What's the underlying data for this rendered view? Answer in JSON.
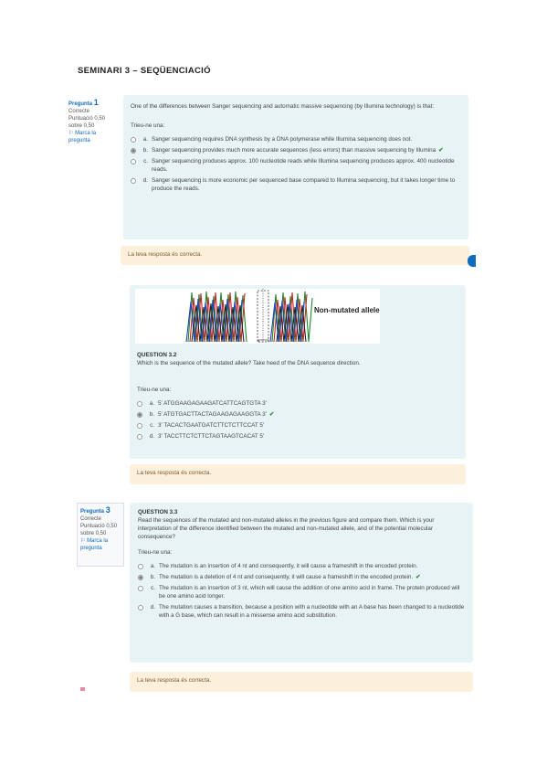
{
  "title": "SEMINARI 3 – SEQÜENCIACIÓ",
  "q1": {
    "info": {
      "label": "Pregunta",
      "number": "1",
      "status": "Correcte",
      "score": "Puntuació 0,50 sobre 0,50",
      "flag": "Marca la pregunta"
    },
    "text": "One of the differences between Sanger sequencing and automatic massive sequencing (by Illumina technology) is that:",
    "prompt": "Trieu-ne una:",
    "answers": [
      {
        "letter": "a.",
        "text": "Sanger sequencing requires DNA synthesis by a DNA polymerase while Illumina sequencing does not.",
        "selected": false,
        "correct": false
      },
      {
        "letter": "b.",
        "text": "Sanger sequencing provides much more accurate sequences (less errors) than massive sequencing by Illumina",
        "selected": true,
        "correct": true
      },
      {
        "letter": "c.",
        "text": "Sanger sequencing produces approx. 100 nucleotide reads while Illumina sequencing produces approx. 400 nucleotide reads.",
        "selected": false,
        "correct": false
      },
      {
        "letter": "d.",
        "text": "Sanger sequencing is more economic per sequenced base compared to Illumina sequencing, but it takes longer time to produce the reads.",
        "selected": false,
        "correct": false
      }
    ],
    "feedback": "La teva resposta és correcta."
  },
  "q2": {
    "chromatogram_label": "Non-mutated allele",
    "heading": "QUESTION 3.2",
    "text": "Which is the sequence of the mutated allele? Take heed of the DNA sequence direction.",
    "prompt": "Trieu-ne una:",
    "answers": [
      {
        "letter": "a.",
        "text": "5' ATGGAAGAGAAGATCATTCAGTGTA 3'",
        "selected": false,
        "correct": false
      },
      {
        "letter": "b.",
        "text": "5' ATGTGACTTACTAGAAGAGAAGGTA 3'",
        "selected": true,
        "correct": true
      },
      {
        "letter": "c.",
        "text": "3' TACACTGAATGATCTTCTCTTCCAT 5'",
        "selected": false,
        "correct": false
      },
      {
        "letter": "d.",
        "text": "3' TACCTTCTCTTCTAGTAAGTCACAT 5'",
        "selected": false,
        "correct": false
      }
    ],
    "feedback": "La teva resposta és correcta."
  },
  "q3": {
    "info": {
      "label": "Pregunta",
      "number": "3",
      "status": "Correcte",
      "score": "Puntuació 0,50 sobre 0,50",
      "flag": "Marca la pregunta"
    },
    "heading": "QUESTION 3.3",
    "text": "Read the sequences of the mutated and non-mutated alleles in the previous figure and compare them. Which is your interpretation of the difference identified between the mutated and non-mutated allele, and of the potential molecular consequence?",
    "prompt": "Trieu-ne una:",
    "answers": [
      {
        "letter": "a.",
        "text": "The mutation is an insertion of 4 nt and consequently, it will cause a frameshift in the encoded protein.",
        "selected": false,
        "correct": false
      },
      {
        "letter": "b.",
        "text": "The mutation is a deletion of 4 nt and consequently, it will cause a frameshift in the encoded protein.",
        "selected": true,
        "correct": true
      },
      {
        "letter": "c.",
        "text": "The mutation is an insertion of 3 nt, which will cause the addition of one amino acid in frame. The protein produced will be one amino acid longer.",
        "selected": false,
        "correct": false
      },
      {
        "letter": "d.",
        "text": "The mutation causes a transition, because a position with a nucleotide with an A base has been changed to a nucleotide with a G base, which can result in a missense amino acid substitution.",
        "selected": false,
        "correct": false
      }
    ],
    "feedback": "La teva resposta és correcta."
  },
  "colors": {
    "question_bg": "#e7f3f5",
    "feedback_bg": "#fcefdc",
    "link": "#0f6cbf",
    "check": "#2a8a3a"
  }
}
